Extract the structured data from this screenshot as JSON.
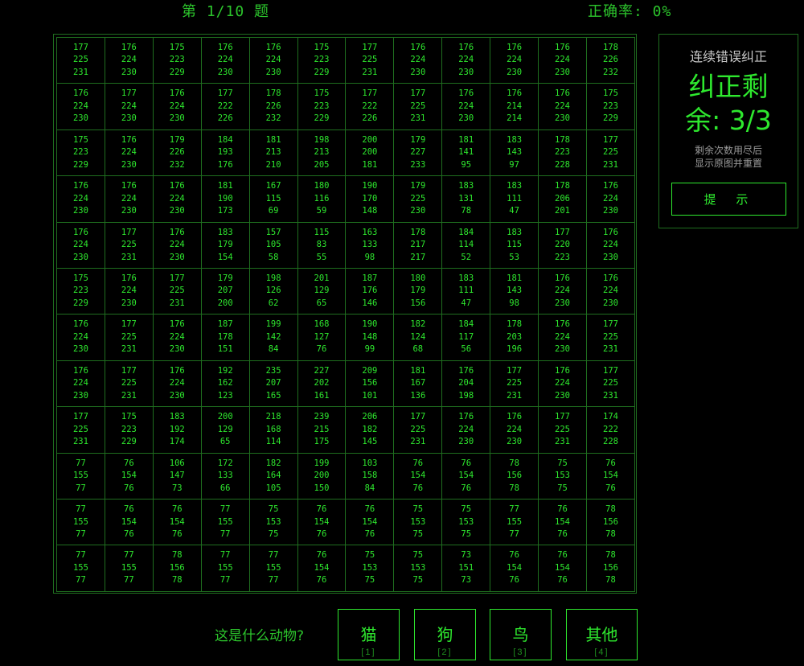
{
  "header": {
    "progress": "第 1/10 题",
    "accuracy": "正确率: 0%"
  },
  "grid": [
    [
      [
        "177",
        "225",
        "231"
      ],
      [
        "176",
        "224",
        "230"
      ],
      [
        "175",
        "223",
        "229"
      ],
      [
        "176",
        "224",
        "230"
      ],
      [
        "176",
        "224",
        "230"
      ],
      [
        "175",
        "223",
        "229"
      ],
      [
        "177",
        "225",
        "231"
      ],
      [
        "176",
        "224",
        "230"
      ],
      [
        "176",
        "224",
        "230"
      ],
      [
        "176",
        "224",
        "230"
      ],
      [
        "176",
        "224",
        "230"
      ],
      [
        "178",
        "226",
        "232"
      ]
    ],
    [
      [
        "176",
        "224",
        "230"
      ],
      [
        "177",
        "224",
        "230"
      ],
      [
        "176",
        "224",
        "230"
      ],
      [
        "177",
        "222",
        "226"
      ],
      [
        "178",
        "226",
        "232"
      ],
      [
        "175",
        "223",
        "229"
      ],
      [
        "177",
        "222",
        "226"
      ],
      [
        "177",
        "225",
        "231"
      ],
      [
        "176",
        "224",
        "230"
      ],
      [
        "176",
        "214",
        "214"
      ],
      [
        "176",
        "224",
        "230"
      ],
      [
        "175",
        "223",
        "229"
      ]
    ],
    [
      [
        "175",
        "223",
        "229"
      ],
      [
        "176",
        "224",
        "230"
      ],
      [
        "179",
        "226",
        "232"
      ],
      [
        "184",
        "193",
        "176"
      ],
      [
        "181",
        "213",
        "210"
      ],
      [
        "198",
        "213",
        "205"
      ],
      [
        "200",
        "200",
        "181"
      ],
      [
        "179",
        "227",
        "233"
      ],
      [
        "181",
        "141",
        "95"
      ],
      [
        "183",
        "143",
        "97"
      ],
      [
        "178",
        "223",
        "228"
      ],
      [
        "177",
        "225",
        "231"
      ]
    ],
    [
      [
        "176",
        "224",
        "230"
      ],
      [
        "176",
        "224",
        "230"
      ],
      [
        "176",
        "224",
        "230"
      ],
      [
        "181",
        "190",
        "173"
      ],
      [
        "167",
        "115",
        "69"
      ],
      [
        "180",
        "116",
        "59"
      ],
      [
        "190",
        "170",
        "148"
      ],
      [
        "179",
        "225",
        "230"
      ],
      [
        "183",
        "131",
        "78"
      ],
      [
        "183",
        "111",
        "47"
      ],
      [
        "178",
        "206",
        "201"
      ],
      [
        "176",
        "224",
        "230"
      ]
    ],
    [
      [
        "176",
        "224",
        "230"
      ],
      [
        "177",
        "225",
        "231"
      ],
      [
        "176",
        "224",
        "230"
      ],
      [
        "183",
        "179",
        "154"
      ],
      [
        "157",
        "105",
        "58"
      ],
      [
        "115",
        "83",
        "55"
      ],
      [
        "163",
        "133",
        "98"
      ],
      [
        "178",
        "217",
        "217"
      ],
      [
        "184",
        "114",
        "52"
      ],
      [
        "183",
        "115",
        "53"
      ],
      [
        "177",
        "220",
        "223"
      ],
      [
        "176",
        "224",
        "230"
      ]
    ],
    [
      [
        "175",
        "223",
        "229"
      ],
      [
        "176",
        "224",
        "230"
      ],
      [
        "177",
        "225",
        "231"
      ],
      [
        "179",
        "207",
        "200"
      ],
      [
        "198",
        "126",
        "62"
      ],
      [
        "201",
        "129",
        "65"
      ],
      [
        "187",
        "176",
        "146"
      ],
      [
        "180",
        "179",
        "156"
      ],
      [
        "183",
        "111",
        "47"
      ],
      [
        "181",
        "143",
        "98"
      ],
      [
        "176",
        "224",
        "230"
      ],
      [
        "176",
        "224",
        "230"
      ]
    ],
    [
      [
        "176",
        "224",
        "230"
      ],
      [
        "177",
        "225",
        "231"
      ],
      [
        "176",
        "224",
        "230"
      ],
      [
        "187",
        "178",
        "151"
      ],
      [
        "199",
        "142",
        "84"
      ],
      [
        "168",
        "127",
        "76"
      ],
      [
        "190",
        "148",
        "99"
      ],
      [
        "182",
        "124",
        "68"
      ],
      [
        "184",
        "117",
        "56"
      ],
      [
        "178",
        "203",
        "196"
      ],
      [
        "176",
        "224",
        "230"
      ],
      [
        "177",
        "225",
        "231"
      ]
    ],
    [
      [
        "176",
        "224",
        "230"
      ],
      [
        "177",
        "225",
        "231"
      ],
      [
        "176",
        "224",
        "230"
      ],
      [
        "192",
        "162",
        "123"
      ],
      [
        "235",
        "207",
        "165"
      ],
      [
        "227",
        "202",
        "161"
      ],
      [
        "209",
        "156",
        "101"
      ],
      [
        "181",
        "167",
        "136"
      ],
      [
        "176",
        "204",
        "198"
      ],
      [
        "177",
        "225",
        "231"
      ],
      [
        "176",
        "224",
        "230"
      ],
      [
        "177",
        "225",
        "231"
      ]
    ],
    [
      [
        "177",
        "225",
        "231"
      ],
      [
        "175",
        "223",
        "229"
      ],
      [
        "183",
        "192",
        "174"
      ],
      [
        "200",
        "129",
        "65"
      ],
      [
        "218",
        "168",
        "114"
      ],
      [
        "239",
        "215",
        "175"
      ],
      [
        "206",
        "182",
        "145"
      ],
      [
        "177",
        "225",
        "231"
      ],
      [
        "176",
        "224",
        "230"
      ],
      [
        "176",
        "224",
        "230"
      ],
      [
        "177",
        "225",
        "231"
      ],
      [
        "174",
        "222",
        "228"
      ]
    ],
    [
      [
        "77",
        "155",
        "77"
      ],
      [
        "76",
        "154",
        "76"
      ],
      [
        "106",
        "147",
        "73"
      ],
      [
        "172",
        "133",
        "66"
      ],
      [
        "182",
        "164",
        "105"
      ],
      [
        "199",
        "200",
        "150"
      ],
      [
        "103",
        "158",
        "84"
      ],
      [
        "76",
        "154",
        "76"
      ],
      [
        "76",
        "154",
        "76"
      ],
      [
        "78",
        "156",
        "78"
      ],
      [
        "75",
        "153",
        "75"
      ],
      [
        "76",
        "154",
        "76"
      ]
    ],
    [
      [
        "77",
        "155",
        "77"
      ],
      [
        "76",
        "154",
        "76"
      ],
      [
        "76",
        "154",
        "76"
      ],
      [
        "77",
        "155",
        "77"
      ],
      [
        "75",
        "153",
        "75"
      ],
      [
        "76",
        "154",
        "76"
      ],
      [
        "76",
        "154",
        "76"
      ],
      [
        "75",
        "153",
        "75"
      ],
      [
        "75",
        "153",
        "75"
      ],
      [
        "77",
        "155",
        "77"
      ],
      [
        "76",
        "154",
        "76"
      ],
      [
        "78",
        "156",
        "78"
      ]
    ],
    [
      [
        "77",
        "155",
        "77"
      ],
      [
        "77",
        "155",
        "77"
      ],
      [
        "78",
        "156",
        "78"
      ],
      [
        "77",
        "155",
        "77"
      ],
      [
        "77",
        "155",
        "77"
      ],
      [
        "76",
        "154",
        "76"
      ],
      [
        "75",
        "153",
        "75"
      ],
      [
        "75",
        "153",
        "75"
      ],
      [
        "73",
        "151",
        "73"
      ],
      [
        "76",
        "154",
        "76"
      ],
      [
        "76",
        "154",
        "76"
      ],
      [
        "78",
        "156",
        "78"
      ]
    ]
  ],
  "panel": {
    "title": "连续错误纠正",
    "remain_line1": "纠正剩",
    "remain_line2": "余: 3/3",
    "note_line1": "剩余次数用尽后",
    "note_line2": "显示原图并重置",
    "hint_button": "提 示"
  },
  "question": "这是什么动物?",
  "answers": [
    {
      "label": "猫",
      "key": "[1]"
    },
    {
      "label": "狗",
      "key": "[2]"
    },
    {
      "label": "鸟",
      "key": "[3]"
    },
    {
      "label": "其他",
      "key": "[4]"
    }
  ],
  "colors": {
    "accent": "#2ee82e",
    "border": "#1f6e1f",
    "background": "#000000"
  }
}
